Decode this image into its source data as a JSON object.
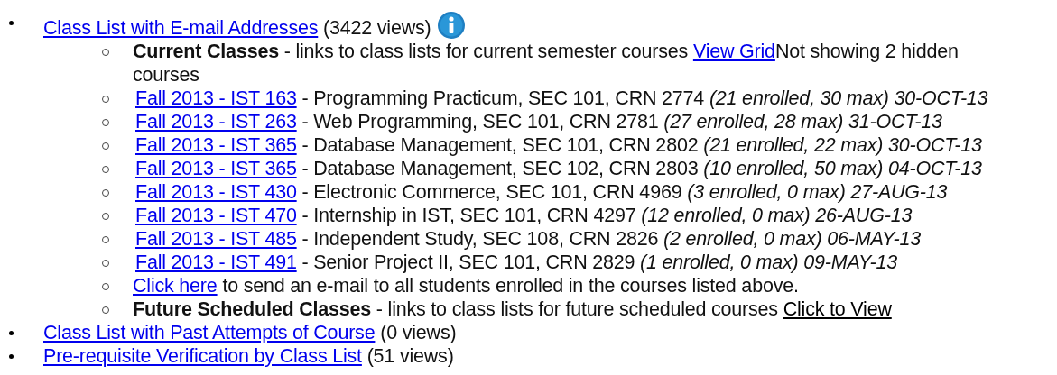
{
  "items": [
    {
      "link": "Class List with E-mail Addresses",
      "views": "(3422 views)",
      "info": true,
      "children": [
        {
          "kind": "section",
          "title": "Current Classes",
          "description": "- links to class lists for current semester courses",
          "link": {
            "text": "View Grid",
            "kind": "blue"
          },
          "note": "Not showing 2 hidden courses"
        },
        {
          "kind": "course",
          "link": "Fall 2013 - IST 163",
          "description": "- Programming Practicum, SEC 101, CRN 2774",
          "detail": "(21 enrolled, 30 max) 30-OCT-13"
        },
        {
          "kind": "course",
          "link": "Fall 2013 - IST 263",
          "description": "- Web Programming, SEC 101, CRN 2781",
          "detail": "(27 enrolled, 28 max) 31-OCT-13"
        },
        {
          "kind": "course",
          "link": "Fall 2013 - IST 365",
          "description": "- Database Management, SEC 101, CRN 2802",
          "detail": "(21 enrolled, 22 max) 30-OCT-13"
        },
        {
          "kind": "course",
          "link": "Fall 2013 - IST 365",
          "description": "- Database Management, SEC 102, CRN 2803",
          "detail": "(10 enrolled, 50 max) 04-OCT-13"
        },
        {
          "kind": "course",
          "link": "Fall 2013 - IST 430",
          "description": "- Electronic Commerce, SEC 101, CRN 4969",
          "detail": "(3 enrolled, 0 max) 27-AUG-13"
        },
        {
          "kind": "course",
          "link": "Fall 2013 - IST 470",
          "description": "- Internship in IST, SEC 101, CRN 4297",
          "detail": "(12 enrolled, 0 max) 26-AUG-13"
        },
        {
          "kind": "course",
          "link": "Fall 2013 - IST 485",
          "description": "- Independent Study, SEC 108, CRN 2826",
          "detail": "(2 enrolled, 0 max) 06-MAY-13"
        },
        {
          "kind": "course",
          "link": "Fall 2013 - IST 491",
          "description": "- Senior Project II, SEC 101, CRN 2829",
          "detail": "(1 enrolled, 0 max) 09-MAY-13"
        },
        {
          "kind": "action",
          "link": "Click here",
          "text": "to send an e-mail to all students enrolled in the courses listed above."
        },
        {
          "kind": "section",
          "title": "Future Scheduled Classes",
          "description": "- links to class lists for future scheduled courses",
          "link": {
            "text": "Click to View",
            "kind": "plain"
          }
        }
      ]
    },
    {
      "link": "Class List with Past Attempts of Course",
      "views": "(0 views)",
      "info": false
    },
    {
      "link": "Pre-requisite Verification by Class List",
      "views": "(51 views)",
      "info": false
    }
  ]
}
